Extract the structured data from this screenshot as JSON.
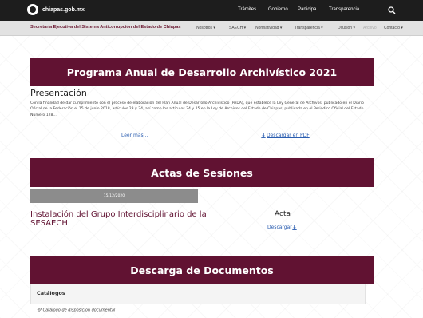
{
  "header": {
    "site": "chiapas.gob.mx",
    "nav": [
      "Trámites",
      "Gobierno",
      "Participa",
      "Transparencia"
    ]
  },
  "subnav": {
    "title": "Secretaría Ejecutiva del Sistema Anticorrupción del Estado de Chiapas",
    "items": [
      {
        "label": "Nosotros ▾",
        "muted": false
      },
      {
        "label": "SAECH ▾",
        "muted": false
      },
      {
        "label": "Normatividad ▾",
        "muted": false
      },
      {
        "label": "Transparencia ▾",
        "muted": false
      },
      {
        "label": "Difusión ▾",
        "muted": false
      },
      {
        "label": "Archivo",
        "muted": true
      },
      {
        "label": "Contacto ▾",
        "muted": false
      }
    ]
  },
  "program": {
    "banner": "Programa Anual de Desarrollo Archivístico 2021",
    "heading": "Presentación",
    "body": "Con la finalidad de dar cumplimiento con el proceso de elaboración del Plan Anual de Desarrollo Archivístico (PADA), que establece la Ley General de Archivos, publicado en el Diario Oficial de la Federación el 15 de junio 2018, artículos 23 y 24, así como los artículos 24 y 25 en la Ley de Archivos del Estado de Chiapas, publicada en el Periódico Oficial del Estado Número 128...",
    "read_more": "Leer mas...",
    "download_pdf": "Descargar en PDF"
  },
  "actas": {
    "banner": "Actas de Sesiones",
    "date": "15/12/2020",
    "title": "Instalación del Grupo Interdisciplinario de la SESAECH",
    "acta_label": "Acta",
    "download": "Descargar"
  },
  "documentos": {
    "banner": "Descarga de Documentos",
    "catalog_label": "Catálogos",
    "catalog_item": "Catálogo de disposición documental"
  },
  "colors": {
    "brand": "#611232",
    "topbar": "#1d1d1d",
    "link": "#2a5db0"
  }
}
